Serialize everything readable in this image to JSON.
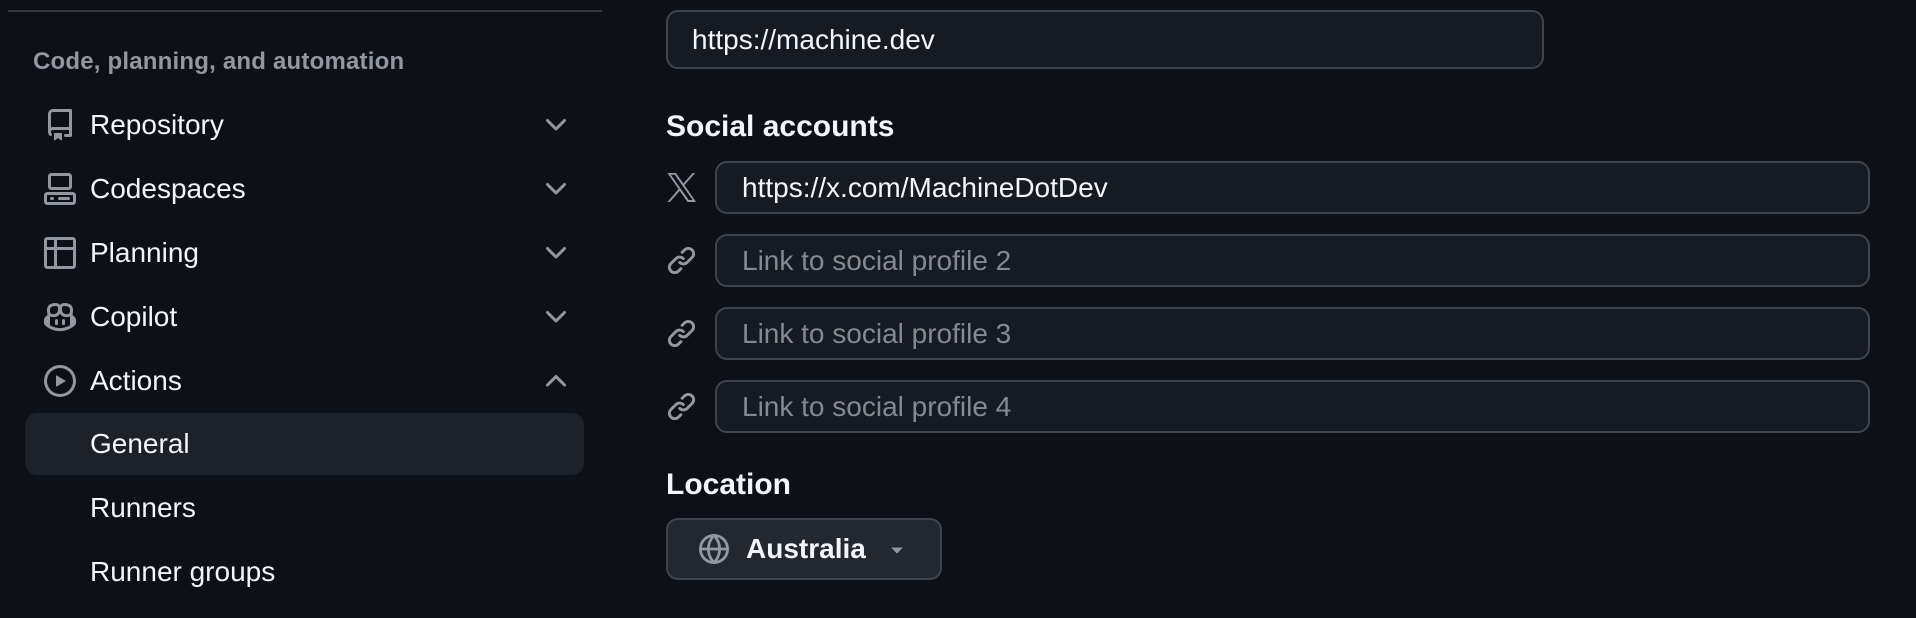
{
  "sidebar": {
    "section_header": "Code, planning, and automation",
    "items": [
      {
        "label": "Repository",
        "icon": "repo-icon",
        "chevron": "down"
      },
      {
        "label": "Codespaces",
        "icon": "codespaces-icon",
        "chevron": "down"
      },
      {
        "label": "Planning",
        "icon": "table-icon",
        "chevron": "down"
      },
      {
        "label": "Copilot",
        "icon": "copilot-icon",
        "chevron": "down"
      },
      {
        "label": "Actions",
        "icon": "play-icon",
        "chevron": "up"
      }
    ],
    "sub_items": [
      {
        "label": "General",
        "selected": true
      },
      {
        "label": "Runners",
        "selected": false
      },
      {
        "label": "Runner groups",
        "selected": false
      }
    ]
  },
  "main": {
    "website_input": {
      "value": "https://machine.dev",
      "placeholder": ""
    },
    "social": {
      "heading": "Social accounts",
      "rows": [
        {
          "icon": "x-logo-icon",
          "value": "https://x.com/MachineDotDev",
          "placeholder": ""
        },
        {
          "icon": "link-icon",
          "value": "",
          "placeholder": "Link to social profile 2"
        },
        {
          "icon": "link-icon",
          "value": "",
          "placeholder": "Link to social profile 3"
        },
        {
          "icon": "link-icon",
          "value": "",
          "placeholder": "Link to social profile 4"
        }
      ]
    },
    "location": {
      "heading": "Location",
      "selected_value": "Australia",
      "icon": "globe-icon"
    }
  },
  "colors": {
    "page_background": "#0d1117",
    "input_background": "#151b23",
    "button_background": "#212830",
    "border": "#3d444d",
    "text": "#f0f6fc",
    "muted_text": "#9198a1",
    "selected_nav_background": "#1b222c"
  }
}
